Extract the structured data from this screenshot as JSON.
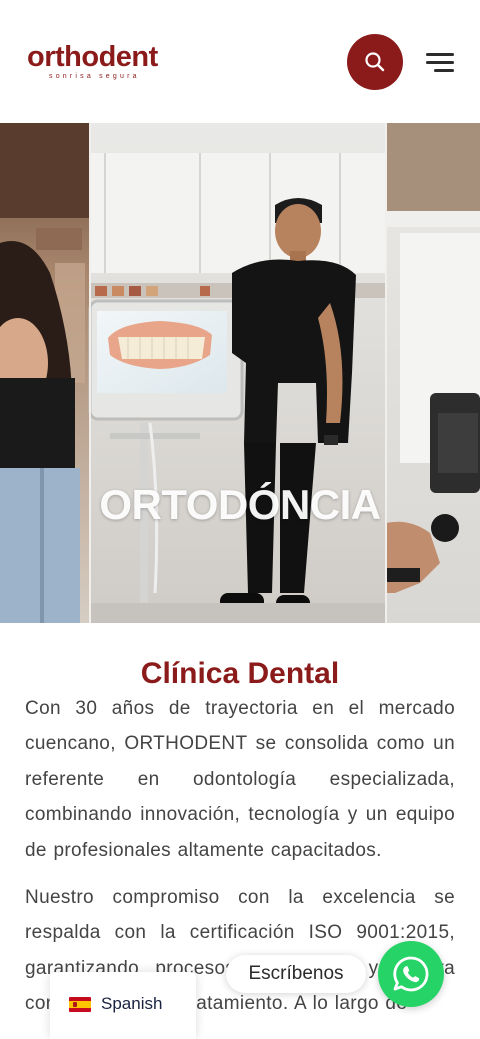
{
  "header": {
    "logo_text": "orthodent",
    "logo_tagline": "sonrisa segura",
    "search_icon": "search-icon",
    "menu_icon": "hamburger-menu-icon"
  },
  "hero": {
    "title": "ORTODÓNCIA"
  },
  "main": {
    "section_title": "Clínica Dental",
    "paragraph_1": "Con 30 años de trayectoria en el mercado cuencano, ORTHODENT se consolida como un referente en odontología especializada, combinando innovación, tecnología y un equipo de profesionales altamente capacitados.",
    "paragraph_2": "Nuestro compromiso con la excelencia se respalda con la certificación ISO 9001:2015, garantizando procesos de calidad y mejora continua en cada tratamiento. A lo largo de"
  },
  "language_switcher": {
    "label": "Spanish",
    "flag_icon": "spain-flag-icon"
  },
  "chat": {
    "label": "Escríbenos",
    "whatsapp_icon": "whatsapp-icon"
  },
  "colors": {
    "brand": "#8b1a1a",
    "text": "#444444",
    "whatsapp": "#25d366"
  }
}
